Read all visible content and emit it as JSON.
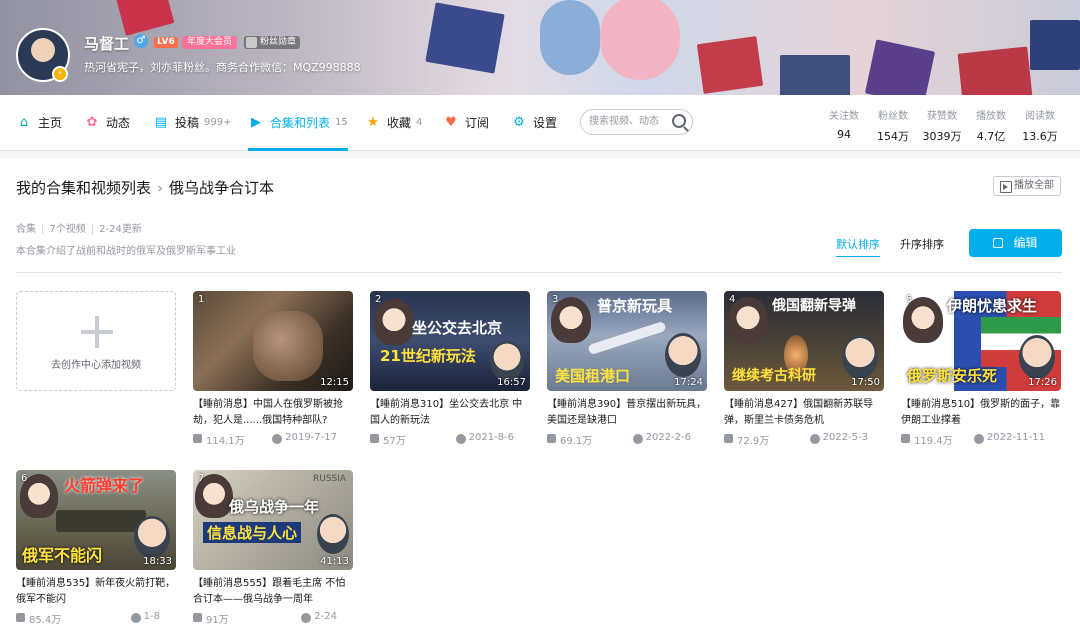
{
  "profile": {
    "name": "马督工",
    "gender_symbol": "♂",
    "level": "LV6",
    "vip_label": "年度大会员",
    "fan_badge": "粉丝勋章",
    "sign": "热河省宪子，刘亦菲粉丝。商务合作微信：MQZ998888"
  },
  "nav": {
    "home": "主页",
    "dynamic": "动态",
    "posts": "投稿",
    "posts_count": "999+",
    "collections": "合集和列表",
    "collections_count": "15",
    "favorites": "收藏",
    "favorites_count": "4",
    "subscriptions": "订阅",
    "settings": "设置",
    "search_placeholder": "搜索视频、动态"
  },
  "stats": [
    {
      "label": "关注数",
      "value": "94"
    },
    {
      "label": "粉丝数",
      "value": "154万"
    },
    {
      "label": "获赞数",
      "value": "3039万"
    },
    {
      "label": "播放数",
      "value": "4.7亿"
    },
    {
      "label": "阅读数",
      "value": "13.6万"
    }
  ],
  "collection": {
    "breadcrumb_root": "我的合集和视频列表",
    "breadcrumb_sep": "›",
    "title": "俄乌战争合订本",
    "play_all": "播放全部",
    "type": "合集",
    "video_count": "7个视频",
    "updated": "2-24更新",
    "description": "本合集介绍了战前和战时的俄军及俄罗斯军事工业",
    "sort_default": "默认排序",
    "sort_asc": "升序排序",
    "edit": "编辑",
    "add_video": "去创作中心添加视频"
  },
  "videos": [
    {
      "index": "1",
      "duration": "12:15",
      "title": "【睡前消息】中国人在俄罗斯被抢劫，犯人是......俄国特种部队?",
      "plays": "114.1万",
      "date": "2019-7-17",
      "caption": ""
    },
    {
      "index": "2",
      "duration": "16:57",
      "title": "【睡前消息310】坐公交去北京 中国人的新玩法",
      "plays": "57万",
      "date": "2021-8-6",
      "caption": "坐公交去北京",
      "caption2": "21世纪新玩法"
    },
    {
      "index": "3",
      "duration": "17:24",
      "title": "【睡前消息390】普京摆出新玩具，美国还是缺港口",
      "plays": "69.1万",
      "date": "2022-2-6",
      "caption": "普京新玩具",
      "caption2": "美国租港口"
    },
    {
      "index": "4",
      "duration": "17:50",
      "title": "【睡前消息427】俄国翻新苏联导弹，斯里兰卡债务危机",
      "plays": "72.9万",
      "date": "2022-5-3",
      "caption": "俄国翻新导弹",
      "caption2": "继续考古科研"
    },
    {
      "index": "5",
      "duration": "17:26",
      "title": "【睡前消息510】俄罗斯的面子，靠伊朗工业撑着",
      "plays": "119.4万",
      "date": "2022-11-11",
      "caption": "伊朗忧患求生",
      "caption2": "俄罗斯安乐死"
    },
    {
      "index": "6",
      "duration": "18:33",
      "title": "【睡前消息535】新年夜火箭打靶，俄军不能闪",
      "plays": "85.4万",
      "date": "1-8",
      "caption": "火箭弹来了",
      "caption2": "俄军不能闪"
    },
    {
      "index": "7",
      "duration": "41:13",
      "title": "【睡前消息555】跟着毛主席 不怕合订本——俄乌战争一周年",
      "plays": "91万",
      "date": "2-24",
      "caption": "俄乌战争一年",
      "caption2": "信息战与人心",
      "map_label": "RUSSIA"
    }
  ],
  "colors": {
    "accent": "#00aeec",
    "vip": "#fb7299",
    "text_muted": "#9499a0"
  }
}
